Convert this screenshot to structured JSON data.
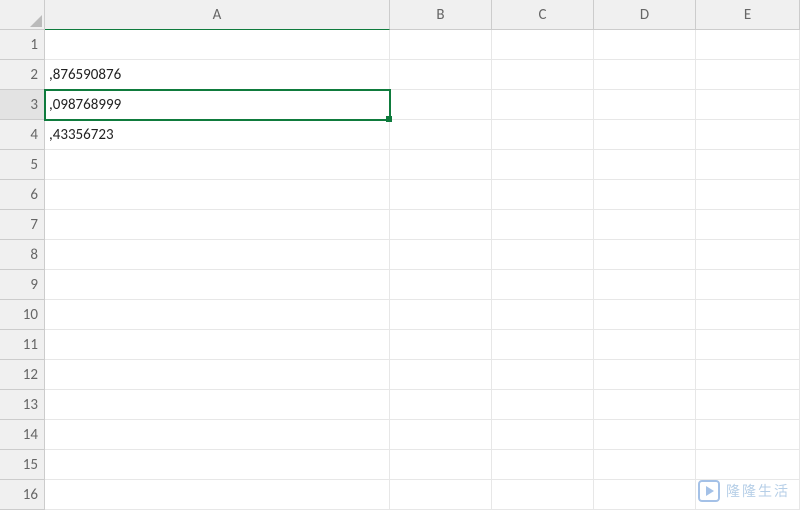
{
  "columns": [
    "A",
    "B",
    "C",
    "D",
    "E"
  ],
  "visible_rows": 16,
  "selected": {
    "row": 3,
    "col": "A"
  },
  "cells": {
    "A2": ",876590876",
    "A3": ",098768999",
    "A4": ",43356723"
  },
  "watermark": {
    "text": "隆隆生活",
    "sub": ""
  }
}
